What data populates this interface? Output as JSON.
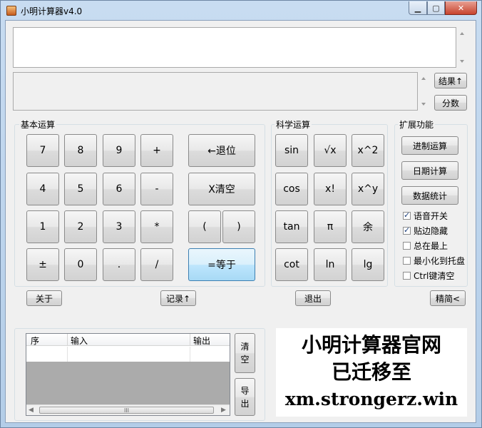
{
  "window": {
    "title": "小明计算器v4.0"
  },
  "display": {
    "expression": "",
    "result": ""
  },
  "side_buttons": {
    "result": "结果↑",
    "fraction": "分数"
  },
  "basic": {
    "label": "基本运算",
    "keys": [
      "7",
      "8",
      "9",
      "+",
      "4",
      "5",
      "6",
      "-",
      "1",
      "2",
      "3",
      "*",
      "±",
      "0",
      ".",
      "/"
    ],
    "backspace": "←退位",
    "clear": "X清空",
    "lparen": "(",
    "rparen": ")",
    "equals": "=等于"
  },
  "science": {
    "label": "科学运算",
    "keys": [
      "sin",
      "√x",
      "x^2",
      "cos",
      "x!",
      "x^y",
      "tan",
      "π",
      "余",
      "cot",
      "ln",
      "lg"
    ]
  },
  "extend": {
    "label": "扩展功能",
    "buttons": [
      "进制运算",
      "日期计算",
      "数据统计"
    ],
    "options": [
      {
        "label": "语音开关",
        "checked": true
      },
      {
        "label": "贴边隐藏",
        "checked": true
      },
      {
        "label": "总在最上",
        "checked": false
      },
      {
        "label": "最小化到托盘",
        "checked": false
      },
      {
        "label": "Ctrl键清空",
        "checked": false
      }
    ]
  },
  "bottom": {
    "about": "关于",
    "record": "记录↑",
    "exit": "退出",
    "compact": "精简<"
  },
  "history": {
    "columns": [
      "序",
      "输入",
      "输出"
    ],
    "clear": "清\n空",
    "export": "导\n出",
    "scroll_grip": "III"
  },
  "banner": {
    "lines": [
      "小明计算器官网",
      "已迁移至",
      "xm.strongerz.win"
    ]
  }
}
